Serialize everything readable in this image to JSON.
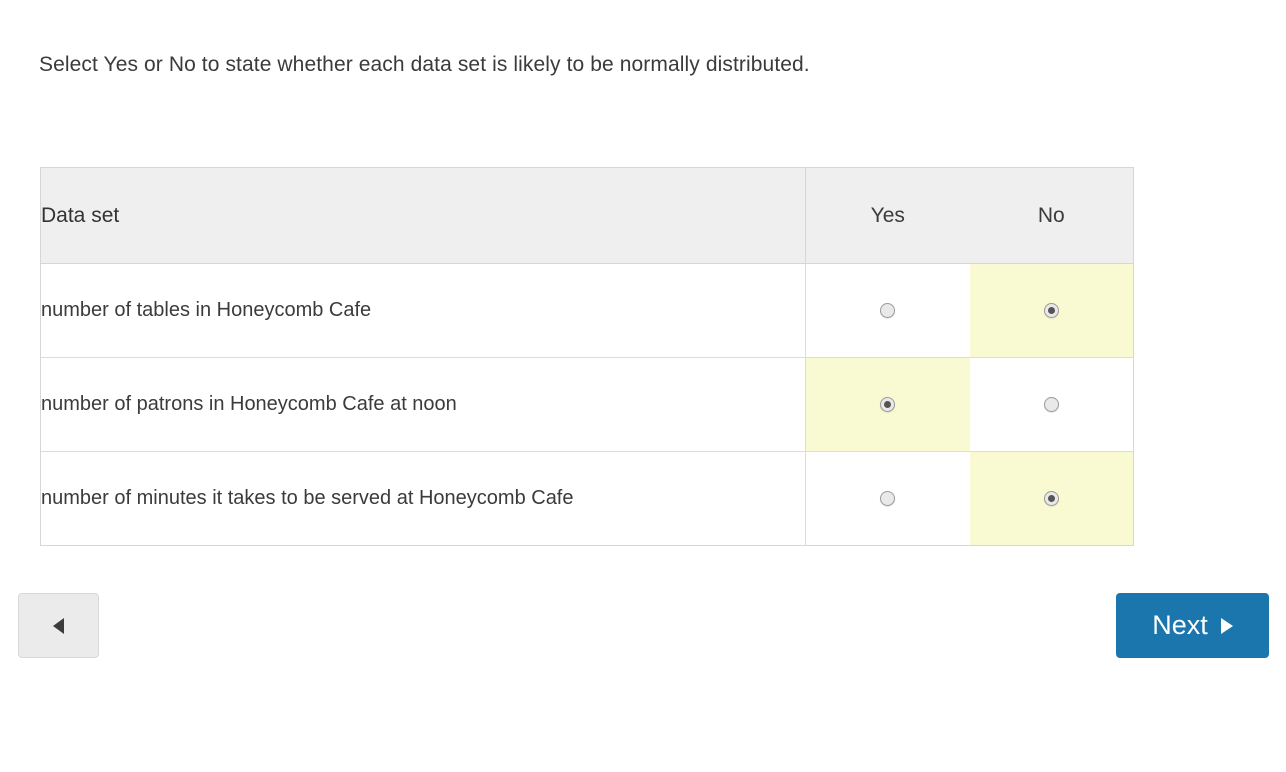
{
  "prompt": "Select Yes or No to state whether each data set is likely to be normally distributed.",
  "table": {
    "headers": {
      "label": "Data set",
      "yes": "Yes",
      "no": "No"
    },
    "rows": [
      {
        "label": "number of tables in Honeycomb Cafe",
        "selected": "no"
      },
      {
        "label": "number of patrons in Honeycomb Cafe at noon",
        "selected": "yes"
      },
      {
        "label": "number of minutes it takes to be served at Honeycomb Cafe",
        "selected": "no"
      }
    ]
  },
  "footer": {
    "back_icon": "triangle-left-icon",
    "next_label": "Next",
    "next_icon": "triangle-right-icon"
  },
  "colors": {
    "accent": "#1b76ad",
    "highlight": "#fafad2",
    "header_bg": "#efefef",
    "border": "#d6d6d6",
    "text": "#3b3b3b"
  }
}
